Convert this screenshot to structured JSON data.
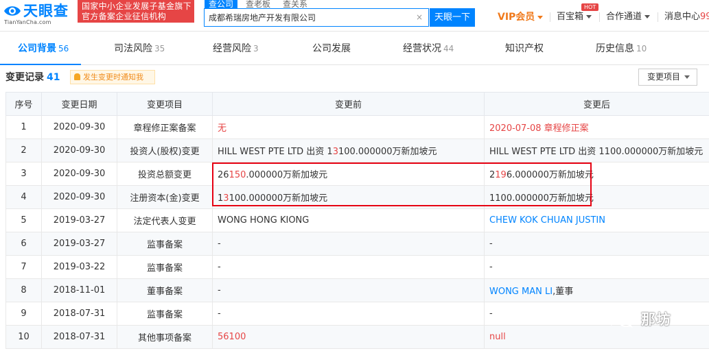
{
  "header": {
    "logo_text": "天眼查",
    "logo_sub": "TianYanCha.com",
    "banner_line1": "国家中小企业发展子基金旗下",
    "banner_line2": "官方备案企业征信机构",
    "search_tabs": [
      "查公司",
      "查老板",
      "查关系"
    ],
    "search_value": "成都希瑞房地产开发有限公司",
    "search_clear": "×",
    "search_button": "天眼一下",
    "vip_label": "VIP会员",
    "treasure_label": "百宝箱",
    "hot_badge": "HOT",
    "cooperation_label": "合作通道",
    "messages_label": "消息中心",
    "messages_count": "99"
  },
  "tabs": [
    {
      "label": "公司背景",
      "count": "56"
    },
    {
      "label": "司法风险",
      "count": "35"
    },
    {
      "label": "经营风险",
      "count": "3"
    },
    {
      "label": "公司发展",
      "count": ""
    },
    {
      "label": "经营状况",
      "count": "44"
    },
    {
      "label": "知识产权",
      "count": ""
    },
    {
      "label": "历史信息",
      "count": "10"
    }
  ],
  "records": {
    "title": "变更记录",
    "count": "41",
    "notify_label": "发生变更时通知我",
    "filter_label": "变更项目",
    "columns": [
      "序号",
      "变更日期",
      "变更项目",
      "变更前",
      "变更后"
    ],
    "rows": [
      {
        "no": "1",
        "date": "2020-09-30",
        "item": "章程修正案备案",
        "before": [
          {
            "t": "无",
            "red": true
          }
        ],
        "after": [
          {
            "t": "2020-07-08 章程修正案",
            "red": true
          }
        ]
      },
      {
        "no": "2",
        "date": "2020-09-30",
        "item": "投资人(股权)变更",
        "before": [
          {
            "t": "HILL WEST PTE LTD 出资 1"
          },
          {
            "t": "3",
            "red": true
          },
          {
            "t": "100.000000万新加坡元"
          }
        ],
        "after": [
          {
            "t": "HILL WEST PTE LTD 出资 1100.000000万新加坡元"
          }
        ]
      },
      {
        "no": "3",
        "date": "2020-09-30",
        "item": "投资总额变更",
        "before": [
          {
            "t": "26"
          },
          {
            "t": "150",
            "red": true
          },
          {
            "t": ".000000万新加坡元"
          }
        ],
        "after": [
          {
            "t": "2"
          },
          {
            "t": "19",
            "red": true
          },
          {
            "t": "6.000000万新加坡元"
          }
        ]
      },
      {
        "no": "4",
        "date": "2020-09-30",
        "item": "注册资本(金)变更",
        "before": [
          {
            "t": "1"
          },
          {
            "t": "3",
            "red": true
          },
          {
            "t": "100.000000万新加坡元"
          }
        ],
        "after": [
          {
            "t": "1100.000000万新加坡元"
          }
        ]
      },
      {
        "no": "5",
        "date": "2019-03-27",
        "item": "法定代表人变更",
        "before": [
          {
            "t": "WONG HONG KIONG"
          }
        ],
        "after": [
          {
            "t": "CHEW KOK CHUAN JUSTIN",
            "blue": true
          }
        ]
      },
      {
        "no": "6",
        "date": "2019-03-27",
        "item": "监事备案",
        "before": [
          {
            "t": "-"
          }
        ],
        "after": [
          {
            "t": "-"
          }
        ]
      },
      {
        "no": "7",
        "date": "2019-03-22",
        "item": "监事备案",
        "before": [
          {
            "t": "-"
          }
        ],
        "after": [
          {
            "t": "-"
          }
        ]
      },
      {
        "no": "8",
        "date": "2018-11-01",
        "item": "董事备案",
        "before": [
          {
            "t": "-"
          }
        ],
        "after": [
          {
            "t": "WONG MAN LI",
            "blue": true
          },
          {
            "t": ",董事"
          }
        ]
      },
      {
        "no": "9",
        "date": "2018-07-31",
        "item": "监事备案",
        "before": [
          {
            "t": "-"
          }
        ],
        "after": [
          {
            "t": "-"
          }
        ]
      },
      {
        "no": "10",
        "date": "2018-07-31",
        "item": "其他事项备案",
        "before": [
          {
            "t": "56100",
            "red": true
          }
        ],
        "after": [
          {
            "t": "null",
            "red": true
          }
        ]
      }
    ]
  },
  "watermark": "那坊",
  "colors": {
    "brand": "#0084ff",
    "accent_red": "#e64545",
    "vip_orange": "#f07a1c",
    "highlight": "#e60012"
  }
}
